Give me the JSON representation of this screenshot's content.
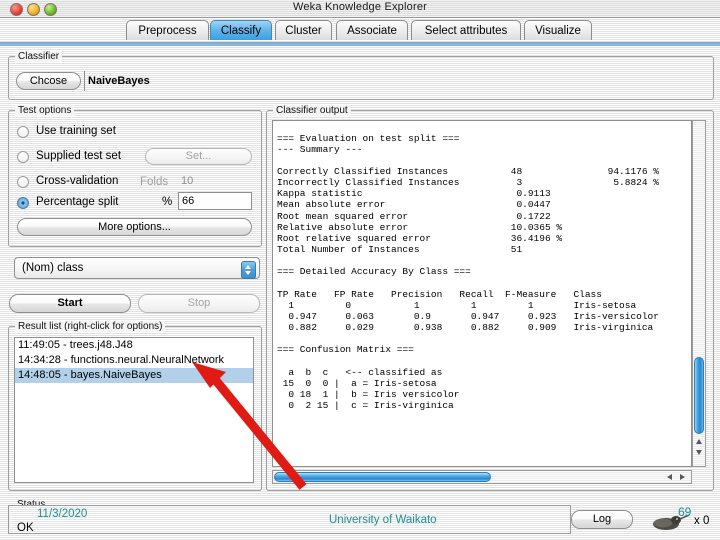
{
  "window": {
    "title": "Weka Knowledge Explorer",
    "controls": [
      "close-button",
      "minimize-button",
      "zoom-button"
    ]
  },
  "tabs": [
    {
      "label": "Preprocess",
      "active": false
    },
    {
      "label": "Classify",
      "active": true
    },
    {
      "label": "Cluster",
      "active": false
    },
    {
      "label": "Associate",
      "active": false
    },
    {
      "label": "Select attributes",
      "active": false
    },
    {
      "label": "Visualize",
      "active": false
    }
  ],
  "classifier": {
    "group_title": "Classifier",
    "choose_button": "Chcose",
    "selected": "NaiveBayes"
  },
  "test_options": {
    "group_title": "Test options",
    "options": [
      {
        "label": "Use training set",
        "selected": false
      },
      {
        "label": "Supplied test set",
        "selected": false
      },
      {
        "label": "Cross-validation",
        "selected": false
      },
      {
        "label": "Percentage split",
        "selected": true
      }
    ],
    "set_button": "Set...",
    "folds_label": "Folds",
    "folds_value": "10",
    "percent_label": "%",
    "percent_value": "66",
    "more_options_button": "More options..."
  },
  "class_selector": {
    "value": "(Nom) class"
  },
  "run_buttons": {
    "start": "Start",
    "stop": "Stop",
    "stop_enabled": false
  },
  "result_list": {
    "group_title": "Result list (right-click for options)",
    "items": [
      {
        "label": "11:49:05 - trees.j48.J48",
        "selected": false
      },
      {
        "label": "14:34:28 - functions.neural.NeuralNetwork",
        "selected": false
      },
      {
        "label": "14:48:05 - bayes.NaiveBayes",
        "selected": true
      }
    ]
  },
  "classifier_output": {
    "group_title": "Classifier output",
    "text": "=== Evaluation on test split ===\n--- Summary ---\n\nCorrectly Classified Instances           48               94.1176 %\nIncorrectly Classified Instances          3                5.8824 %\nKappa statistic                           0.9113\nMean absolute error                       0.0447\nRoot mean squared error                   0.1722\nRelative absolute error                  10.0365 %\nRoot relative squared error              36.4196 %\nTotal Number of Instances                51\n\n=== Detailed Accuracy By Class ===\n\nTP Rate   FP Rate   Precision   Recall  F-Measure   Class\n  1         0           1         1         1       Iris-setosa\n  0.947     0.063       0.9       0.947     0.923   Iris-versicolor\n  0.882     0.029       0.938     0.882     0.909   Iris-virginica\n\n=== Confusion Matrix ===\n\n  a  b  c   <-- classified as\n 15  0  0 |  a = Iris-setosa\n  0 18  1 |  b = Iris versicolor\n  0  2 15 |  c = Iris-virginica"
  },
  "status": {
    "group_title": "Status",
    "state": "OK",
    "date": "11/3/2020",
    "institution": "University of Waikato",
    "log_button": "Log",
    "bird_count": "69",
    "task_count": "x 0"
  },
  "colors": {
    "accent": "#35a2e4",
    "selection": "#b3d0ea",
    "teal": "#1a8f96",
    "annotation_arrow": "#e01b14"
  }
}
